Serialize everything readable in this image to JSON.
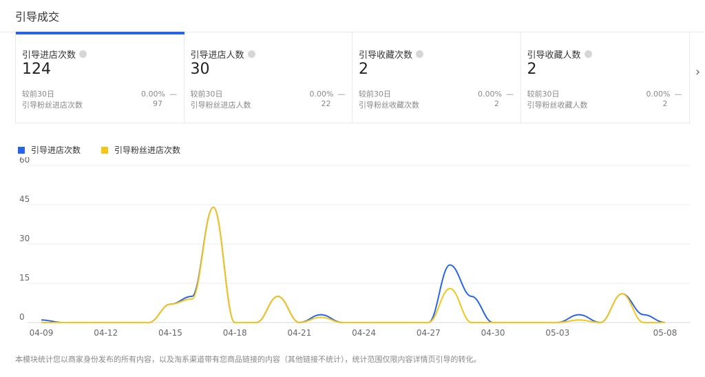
{
  "header": {
    "title": "引导成交"
  },
  "cards": [
    {
      "title": "引导进店次数",
      "value": "124",
      "compare_label": "较前30日",
      "compare_value": "0.00%",
      "compare_trend": "—",
      "sub_label": "引导粉丝进店次数",
      "sub_value": "97"
    },
    {
      "title": "引导进店人数",
      "value": "30",
      "compare_label": "较前30日",
      "compare_value": "0.00%",
      "compare_trend": "—",
      "sub_label": "引导粉丝进店人数",
      "sub_value": "22"
    },
    {
      "title": "引导收藏次数",
      "value": "2",
      "compare_label": "较前30日",
      "compare_value": "0.00%",
      "compare_trend": "—",
      "sub_label": "引导粉丝收藏次数",
      "sub_value": "2"
    },
    {
      "title": "引导收藏人数",
      "value": "2",
      "compare_label": "较前30日",
      "compare_value": "0.00%",
      "compare_trend": "—",
      "sub_label": "引导粉丝收藏人数",
      "sub_value": "2"
    }
  ],
  "next_icon": "chevron-right-icon",
  "colors": {
    "accent": "#2563eb",
    "series1": "#2563eb",
    "series2": "#f5c518",
    "grid": "#ececec"
  },
  "chart_data": {
    "type": "line",
    "smooth": true,
    "grid": true,
    "legend_position": "top-left",
    "ylim": [
      0,
      60
    ],
    "yticks": [
      0,
      15,
      30,
      45,
      60
    ],
    "x": [
      "04-09",
      "04-10",
      "04-11",
      "04-12",
      "04-13",
      "04-14",
      "04-15",
      "04-16",
      "04-17",
      "04-18",
      "04-19",
      "04-20",
      "04-21",
      "04-22",
      "04-23",
      "04-24",
      "04-25",
      "04-26",
      "04-27",
      "04-28",
      "04-29",
      "04-30",
      "05-01",
      "05-02",
      "05-03",
      "05-04",
      "05-05",
      "05-06",
      "05-07",
      "05-08"
    ],
    "xtick_labels": [
      "04-09",
      "04-12",
      "04-15",
      "04-18",
      "04-21",
      "04-24",
      "04-27",
      "04-30",
      "05-03",
      "05-08"
    ],
    "series": [
      {
        "name": "引导进店次数",
        "color": "#2563eb",
        "values": [
          1,
          0,
          0,
          0,
          0,
          0,
          7,
          10,
          44,
          0,
          0,
          10,
          0,
          3,
          0,
          0,
          0,
          0,
          0,
          22,
          10,
          0,
          0,
          0,
          0,
          3,
          0,
          11,
          3,
          0
        ]
      },
      {
        "name": "引导粉丝进店次数",
        "color": "#f5c518",
        "values": [
          0,
          0,
          0,
          0,
          0,
          0,
          7,
          9,
          44,
          0,
          0,
          10,
          0,
          2,
          0,
          0,
          0,
          0,
          0,
          13,
          0,
          0,
          0,
          0,
          0,
          1,
          0,
          11,
          0,
          0
        ]
      }
    ]
  },
  "footnote": "本模块统计您以商家身份发布的所有内容，以及淘系渠道带有您商品链接的内容（其他链接不统计），统计范围仅限内容详情页引导的转化。"
}
